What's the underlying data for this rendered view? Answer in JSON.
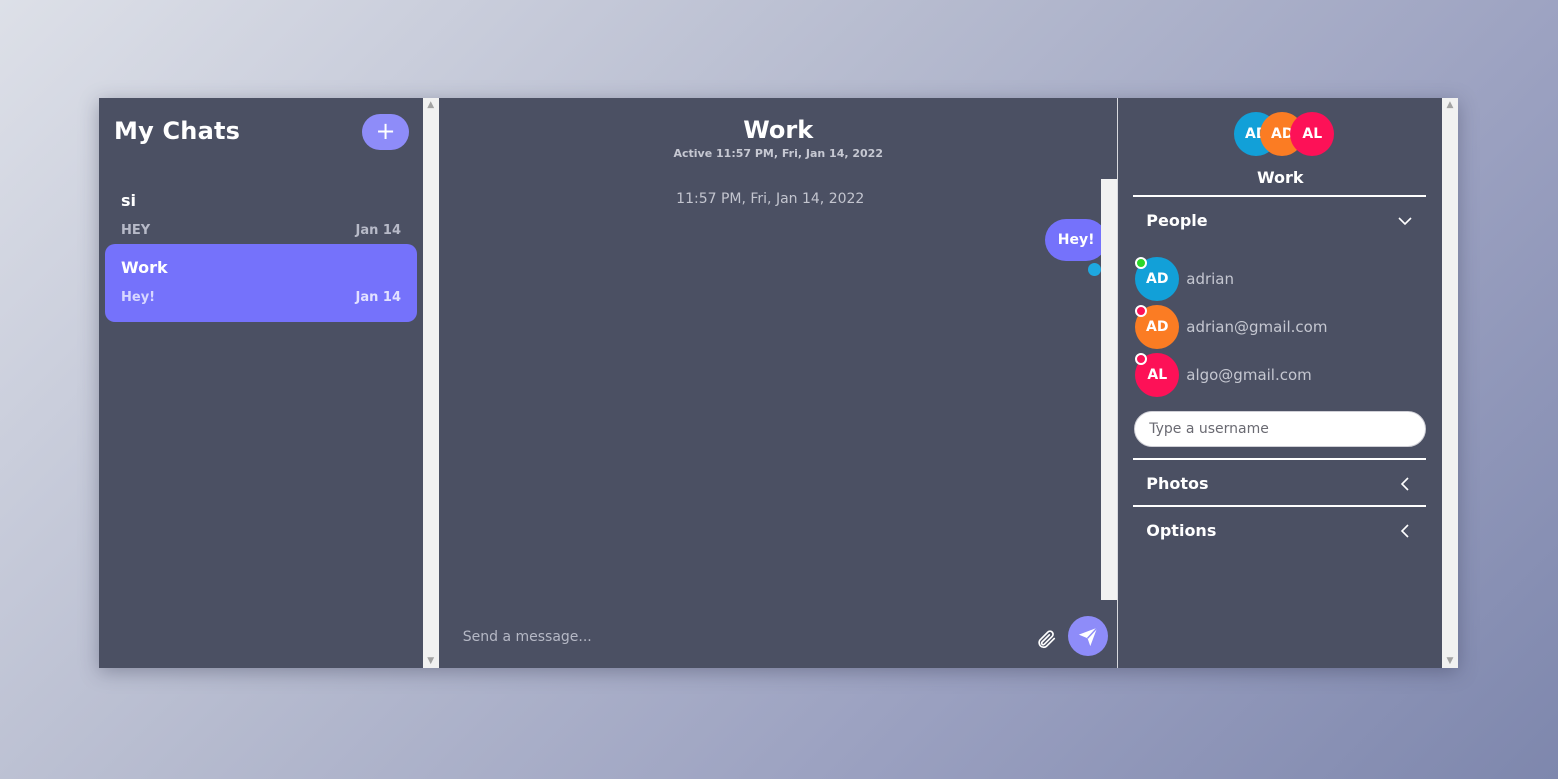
{
  "sidebar": {
    "title": "My Chats",
    "new_chat_icon": "plus-icon",
    "new_chat_symbol": "+",
    "chats": [
      {
        "name": "si",
        "preview": "HEY",
        "date": "Jan 14",
        "active": false
      },
      {
        "name": "Work",
        "preview": "Hey!",
        "date": "Jan 14",
        "active": true
      }
    ]
  },
  "chat": {
    "title": "Work",
    "subtitle": "Active 11:57 PM, Fri, Jan 14, 2022",
    "timestamp": "11:57 PM, Fri, Jan 14, 2022",
    "messages": [
      {
        "text": "Hey!",
        "mine": true
      }
    ],
    "input_placeholder": "Send a message...",
    "attach_icon": "paperclip-icon",
    "send_icon": "send-icon"
  },
  "details": {
    "avatars": [
      "AD",
      "AD",
      "AL"
    ],
    "name": "Work",
    "people_label": "People",
    "people": [
      {
        "initials": "AD",
        "name": "adrian",
        "online": true
      },
      {
        "initials": "AD",
        "name": "adrian@gmail.com",
        "online": false
      },
      {
        "initials": "AL",
        "name": "algo@gmail.com",
        "online": false
      }
    ],
    "username_placeholder": "Type a username",
    "photos_label": "Photos",
    "options_label": "Options"
  },
  "colors": {
    "panel": "#4b5063",
    "accent": "#7572fb",
    "button": "#8e8cf9",
    "avatar_blue": "#12a0d8",
    "avatar_orange": "#fb7c23",
    "avatar_red": "#fd1157",
    "online": "#2bd62b"
  }
}
